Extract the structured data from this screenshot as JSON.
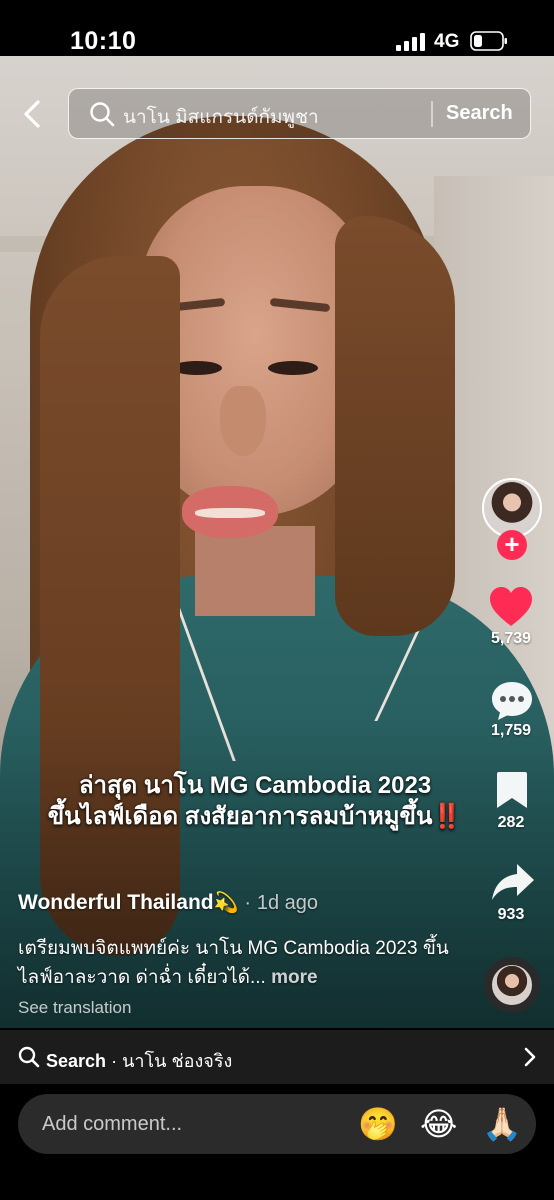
{
  "status_bar": {
    "time": "10:10",
    "network": "4G"
  },
  "search": {
    "query": "นาโน มิสแกรนด์กัมพูชา",
    "button_label": "Search"
  },
  "rail": {
    "likes": "5,739",
    "comments": "1,759",
    "saves": "282",
    "shares": "933",
    "follow_symbol": "+"
  },
  "overlay_caption": {
    "line1": "ล่าสุด นาโน MG Cambodia 2023",
    "line2": "ขึ้นไลฟ์เดือด สงสัยอาการลมบ้าหมูขึ้น",
    "line2_suffix": "‼️"
  },
  "post": {
    "author": "Wonderful Thailand",
    "author_emoji": "💫",
    "separator": "·",
    "posted": "1d ago",
    "description": "เตรียมพบจิตแพทย์ค่ะ นาโน MG Cambodia 2023 ขึ้นไลฟ์อาละวาด ด่าฉ่ำ เดี๋ยวได้...",
    "more_label": "more",
    "see_translation": "See translation"
  },
  "related_search": {
    "label": "Search",
    "separator": "·",
    "term": "นาโน ช่องจริง"
  },
  "comment_bar": {
    "placeholder": "Add comment...",
    "emojis": [
      "🤭",
      "😂",
      "🙏🏻"
    ]
  },
  "colors": {
    "accent": "#fe2c55",
    "like_red": "#fe2c55",
    "bar_bg": "#1c1c1c",
    "input_bg": "#2b2b2b"
  }
}
